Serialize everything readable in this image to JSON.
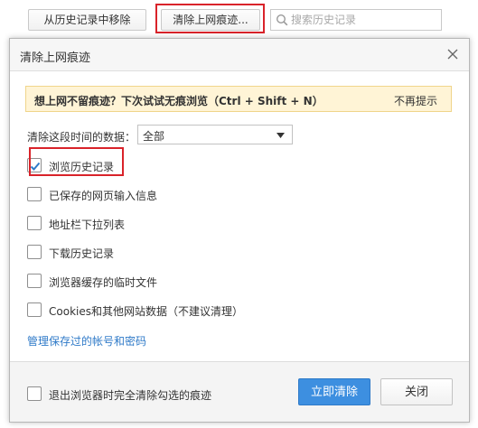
{
  "toolbar": {
    "remove_label": "从历史记录中移除",
    "clear_label": "清除上网痕迹...",
    "search_placeholder": "搜索历史记录"
  },
  "dialog": {
    "title": "清除上网痕迹",
    "banner": {
      "text": "想上网不留痕迹？下次试试无痕浏览（Ctrl + Shift + N）",
      "dismiss": "不再提示"
    },
    "range": {
      "label": "清除这段时间的数据：",
      "selected": "全部"
    },
    "options": [
      {
        "label": "浏览历史记录",
        "checked": true
      },
      {
        "label": "已保存的网页输入信息",
        "checked": false
      },
      {
        "label": "地址栏下拉列表",
        "checked": false
      },
      {
        "label": "下载历史记录",
        "checked": false
      },
      {
        "label": "浏览器缓存的临时文件",
        "checked": false
      },
      {
        "label": "Cookies和其他网站数据（不建议清理）",
        "checked": false
      }
    ],
    "manage_link": "管理保存过的帐号和密码",
    "footer": {
      "exit_option": {
        "label": "退出浏览器时完全清除勾选的痕迹",
        "checked": false
      },
      "clear_now": "立即清除",
      "close": "关闭"
    }
  },
  "colors": {
    "accent": "#3d8fe0",
    "link": "#2f7ac8",
    "highlight": "#d9232a",
    "banner_bg": "#fff4d6",
    "banner_border": "#f0d58b"
  },
  "icons": {
    "search": "search-icon",
    "close": "close-icon",
    "dropdown": "chevron-down-icon",
    "check": "checkmark-icon"
  }
}
